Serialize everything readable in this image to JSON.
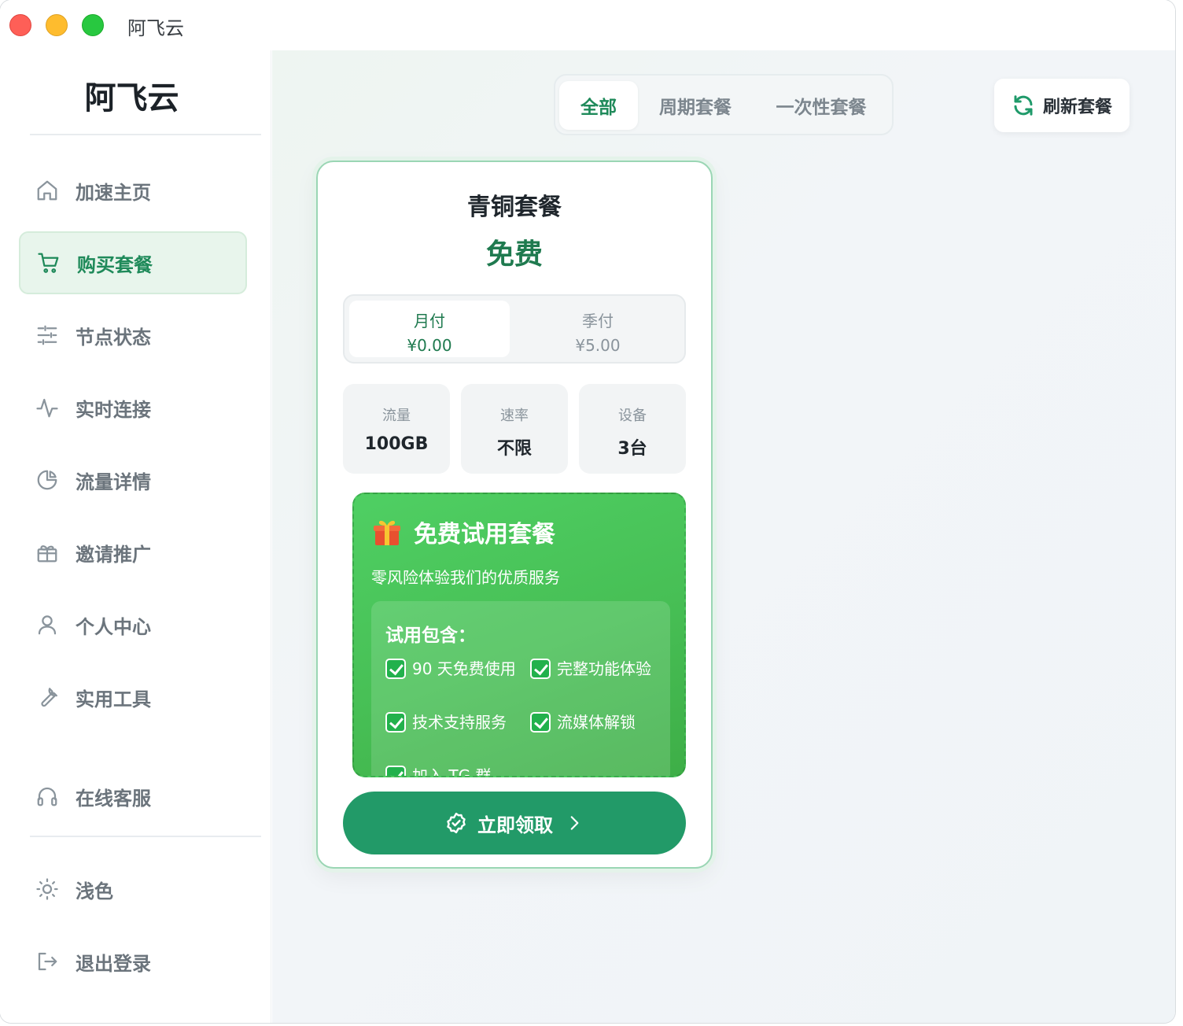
{
  "window": {
    "title": "阿飞云"
  },
  "sidebar": {
    "brand": "阿飞云",
    "items": [
      {
        "label": "加速主页",
        "icon": "home-icon"
      },
      {
        "label": "购买套餐",
        "icon": "cart-icon",
        "active": true
      },
      {
        "label": "节点状态",
        "icon": "sliders-icon"
      },
      {
        "label": "实时连接",
        "icon": "activity-icon"
      },
      {
        "label": "流量详情",
        "icon": "pie-chart-icon"
      },
      {
        "label": "邀请推广",
        "icon": "gift-icon"
      },
      {
        "label": "个人中心",
        "icon": "user-icon"
      },
      {
        "label": "实用工具",
        "icon": "wrench-icon"
      }
    ],
    "support": {
      "label": "在线客服",
      "icon": "headset-icon"
    },
    "theme": {
      "label": "浅色",
      "icon": "sun-icon"
    },
    "logout": {
      "label": "退出登录",
      "icon": "logout-icon"
    }
  },
  "filters": {
    "tabs": [
      "全部",
      "周期套餐",
      "一次性套餐"
    ],
    "active": "全部"
  },
  "refresh": {
    "label": "刷新套餐",
    "icon": "refresh-icon"
  },
  "plan": {
    "name": "青铜套餐",
    "price": "免费",
    "periods": [
      {
        "label": "月付",
        "amount": "¥0.00",
        "active": true
      },
      {
        "label": "季付",
        "amount": "¥5.00"
      }
    ],
    "stats": [
      {
        "key": "流量",
        "value": "100GB"
      },
      {
        "key": "速率",
        "value": "不限"
      },
      {
        "key": "设备",
        "value": "3台"
      }
    ],
    "trial": {
      "title": "免费试用套餐",
      "subtitle": "零风险体验我们的优质服务",
      "includes_title": "试用包含：",
      "features": [
        "90 天免费使用",
        "完整功能体验",
        "技术支持服务",
        "流媒体解锁",
        "加入 TG 群"
      ]
    },
    "cta": "立即领取"
  },
  "colors": {
    "accent": "#1f8a5a",
    "button": "#229a68",
    "trial_green": "#4cc45c"
  }
}
